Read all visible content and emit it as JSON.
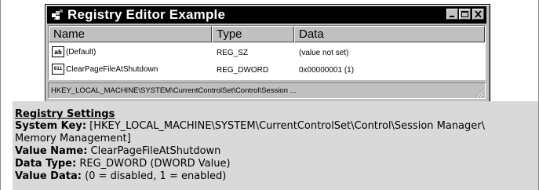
{
  "window": {
    "title": "Registry Editor Example",
    "columns": [
      "Name",
      "Type",
      "Data"
    ],
    "rows": [
      {
        "icon": "string-value-icon",
        "icon_glyph": "ab",
        "name": "(Default)",
        "type": "REG_SZ",
        "data": "(value not set)"
      },
      {
        "icon": "binary-value-icon",
        "icon_glyph": "011",
        "name": "ClearPageFileAtShutdown",
        "type": "REG_DWORD",
        "data": "0x00000001 (1)"
      }
    ],
    "status_path": "HKEY_LOCAL_MACHINE\\SYSTEM\\CurrentControlSet\\Control\\Session ..."
  },
  "settings": {
    "heading": "Registry Settings",
    "system_key_label": "System Key:",
    "system_key_value": "[HKEY_LOCAL_MACHINE\\SYSTEM\\CurrentControlSet\\Control\\Session Manager\\",
    "system_key_value_cont": "Memory Management]",
    "value_name_label": "Value Name:",
    "value_name_value": "ClearPageFileAtShutdown",
    "data_type_label": "Data Type:",
    "data_type_value": "REG_DWORD (DWORD Value)",
    "value_data_label": "Value Data:",
    "value_data_value": "(0 = disabled, 1 = enabled)"
  },
  "colors": {
    "window_face": "#c0c0c0",
    "titlebar": "#000000",
    "settings_bg": "#d9d9d9"
  }
}
